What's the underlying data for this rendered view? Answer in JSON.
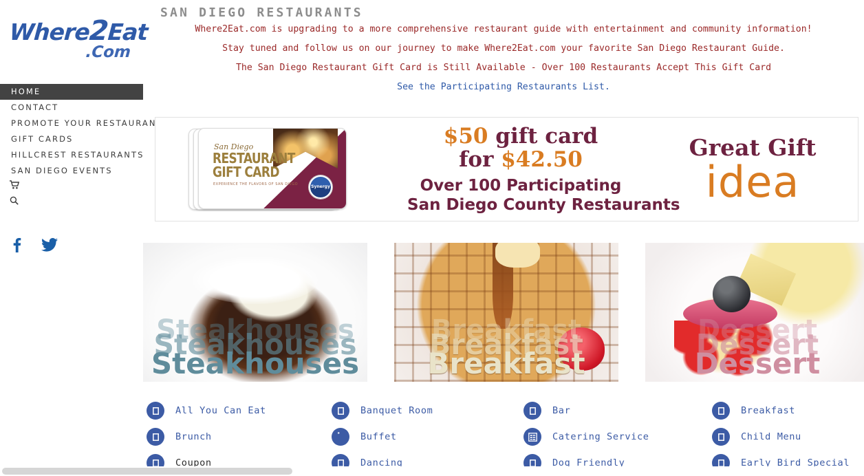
{
  "brand": {
    "logo_line1": "Where2Eat",
    "logo_line1_pre": "Where",
    "logo_line1_num": "2",
    "logo_line1_post": "Eat",
    "logo_line2": ".Com",
    "logo_color": "#2f5aa8"
  },
  "sidebar": {
    "items": [
      {
        "label": "HOME",
        "active": true
      },
      {
        "label": "CONTACT",
        "active": false
      },
      {
        "label": "PROMOTE YOUR RESTAURANT",
        "active": false
      },
      {
        "label": "GIFT CARDS",
        "active": false
      },
      {
        "label": "HILLCREST RESTAURANTS",
        "active": false
      },
      {
        "label": "SAN DIEGO EVENTS",
        "active": false
      }
    ],
    "cart_icon": "shopping-cart-icon",
    "cart_glyph": "🛒",
    "search_icon": "search-icon",
    "search_glyph": "⌕",
    "social": [
      {
        "name": "facebook-icon",
        "color": "#1a5fa8"
      },
      {
        "name": "twitter-icon",
        "color": "#1a5fa8"
      }
    ]
  },
  "header": {
    "title": "SAN DIEGO RESTAURANTS",
    "title_color": "#8d8d8d",
    "announcements": [
      "Where2Eat.com is upgrading to a more comprehensive restaurant guide with entertainment and community information!",
      "Stay tuned and follow us on our journey to make Where2Eat.com your favorite San Diego Restaurant Guide.",
      "The San Diego Restaurant Gift Card is Still Available - Over 100 Restaurants Accept This Gift Card"
    ],
    "announce_color": "#9a2828",
    "link_text": "See the Participating Restaurants List.",
    "link_color": "#2f5aa8"
  },
  "banner": {
    "card": {
      "brand_script": "San Diego",
      "line1": "RESTAURANT",
      "line2": "GIFT CARD",
      "tagline": "EXPERIENCE THE FLAVORS OF SAN DIEGO",
      "badge": "Synergy"
    },
    "offer_line1_amount": "$50",
    "offer_line1_rest": " gift card",
    "offer_line2_pre": "for ",
    "offer_line2_amount": "$42.50",
    "offer_line3": "Over 100 Participating",
    "offer_line4": "San Diego County Restaurants",
    "gift_line1": "Great Gift",
    "gift_line2": "idea",
    "maroon": "#6d2240",
    "orange": "#d97c22"
  },
  "tiles": [
    {
      "label": "Steakhouses",
      "image": "grilled-steak-photo",
      "text_color": "#5f8c9b"
    },
    {
      "label": "Breakfast",
      "image": "waffle-with-syrup-photo",
      "text_color": "#e9e3c9"
    },
    {
      "label": "Dessert",
      "image": "cherry-dessert-photo",
      "text_color": "#cf8ea0"
    }
  ],
  "features": {
    "link_color": "#3c5ba5",
    "rows": [
      [
        {
          "label": "All You Can Eat",
          "icon": "square-outline-icon",
          "dark": false
        },
        {
          "label": "Banquet Room",
          "icon": "square-outline-icon",
          "dark": false
        },
        {
          "label": "Bar",
          "icon": "square-outline-icon",
          "dark": false
        },
        {
          "label": "Breakfast",
          "icon": "square-outline-icon",
          "dark": false
        }
      ],
      [
        {
          "label": "Brunch",
          "icon": "square-outline-icon",
          "dark": false
        },
        {
          "label": "Buffet",
          "icon": "filled-circle-icon",
          "dark": false
        },
        {
          "label": "Catering Service",
          "icon": "list-menu-icon",
          "dark": false
        },
        {
          "label": "Child Menu",
          "icon": "square-outline-icon",
          "dark": false
        }
      ],
      [
        {
          "label": "Coupon",
          "icon": "square-outline-icon",
          "dark": true
        },
        {
          "label": "Dancing",
          "icon": "square-outline-icon",
          "dark": false
        },
        {
          "label": "Dog Friendly",
          "icon": "square-outline-icon",
          "dark": false
        },
        {
          "label": "Early Bird Special",
          "icon": "square-outline-icon",
          "dark": false
        }
      ]
    ]
  },
  "scrollbar": {
    "orientation": "horizontal",
    "thumb_color": "#d6d6d6"
  }
}
